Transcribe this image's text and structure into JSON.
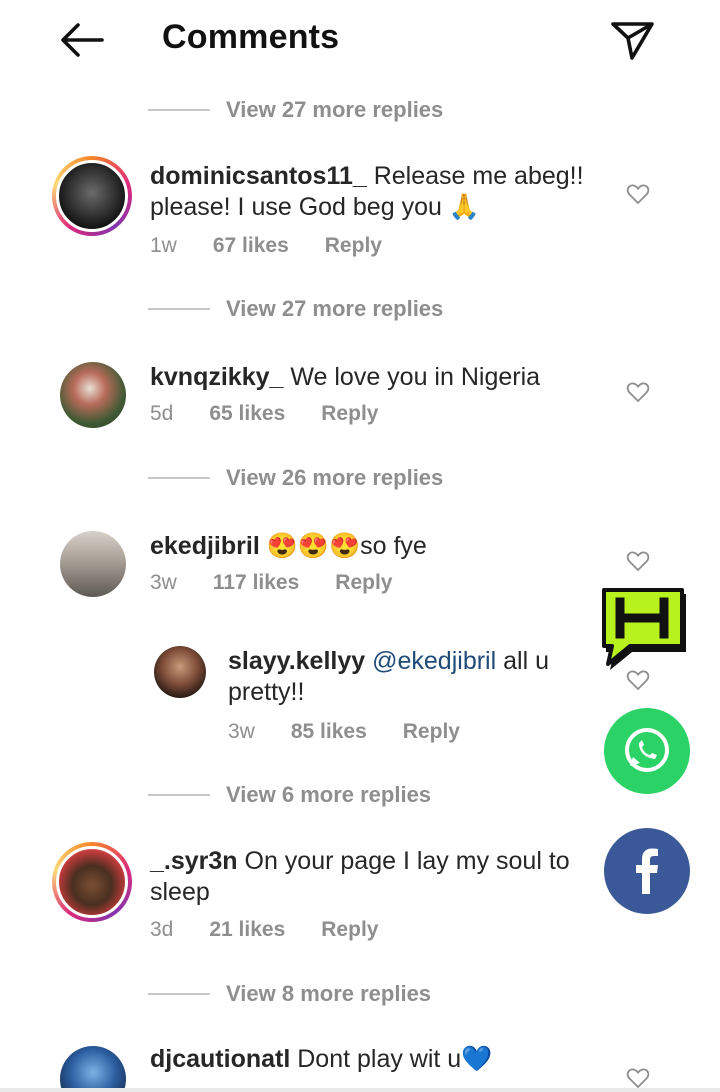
{
  "header": {
    "title": "Comments"
  },
  "view_more": {
    "v1": "View 27 more replies",
    "v2": "View 27 more replies",
    "v3": "View 26 more replies",
    "v4": "View 6 more replies",
    "v5": "View 8 more replies"
  },
  "comments": [
    {
      "username": "dominicsantos11_",
      "text": "Release me abeg!! please! I use God beg you 🙏",
      "time": "1w",
      "likes": "67 likes",
      "reply": "Reply"
    },
    {
      "username": "kvnqzikky_",
      "text": "We love you in Nigeria",
      "time": "5d",
      "likes": "65 likes",
      "reply": "Reply"
    },
    {
      "username": "ekedjibril",
      "text": "😍😍😍so fye",
      "time": "3w",
      "likes": "117 likes",
      "reply": "Reply"
    },
    {
      "username": "_.syr3n",
      "text": "On your page I lay my soul to sleep",
      "time": "3d",
      "likes": "21 likes",
      "reply": "Reply"
    },
    {
      "username": "djcautionatl",
      "text": "Dont play wit u💙"
    }
  ],
  "reply_comment": {
    "username": "slayy.kellyy",
    "mention": "@ekedjibril",
    "text": " all u pretty!!",
    "time": "3w",
    "likes": "85 likes",
    "reply": "Reply"
  },
  "colors": {
    "whatsapp": "#2bd366",
    "facebook": "#3b5998",
    "h_logo": "#b7f21f",
    "mention": "#1f4b78"
  },
  "icons": [
    "back-arrow-icon",
    "send-icon",
    "heart-icon",
    "h-logo-icon",
    "whatsapp-icon",
    "facebook-icon"
  ]
}
